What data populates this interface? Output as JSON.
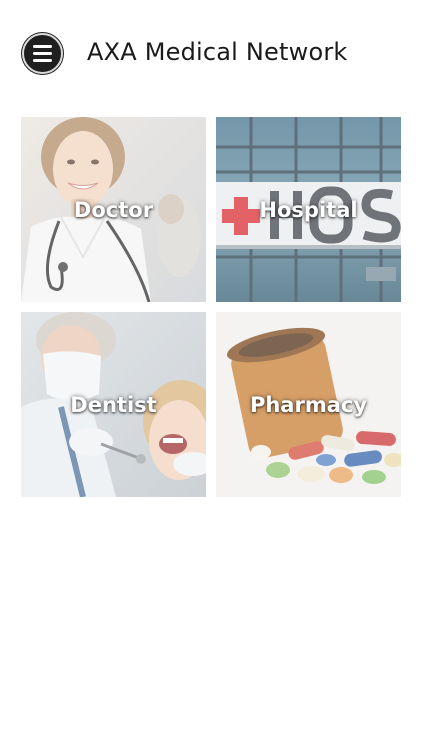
{
  "header": {
    "title": "AXA Medical Network",
    "menu_icon": "hamburger-menu-icon"
  },
  "tiles": [
    {
      "label": "Doctor",
      "icon": "doctor-photo"
    },
    {
      "label": "Hospital",
      "icon": "hospital-photo"
    },
    {
      "label": "Dentist",
      "icon": "dentist-photo"
    },
    {
      "label": "Pharmacy",
      "icon": "pharmacy-photo"
    }
  ],
  "colors": {
    "background": "#ffffff",
    "title_text": "#1a1a1a",
    "menu_button": "#1f1f1f",
    "tile_label": "#ffffff",
    "hospital_cross": "#d7262b"
  }
}
